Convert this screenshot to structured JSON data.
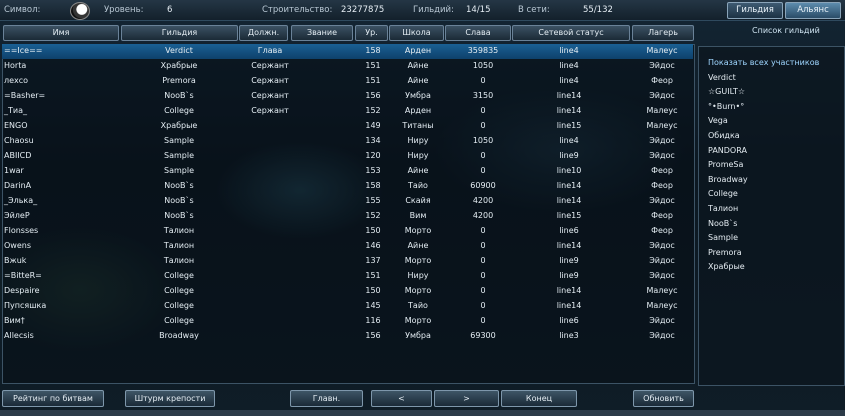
{
  "topbar": {
    "symbol_label": "Символ:",
    "level_label": "Уровень:",
    "level_value": "6",
    "construction_label": "Строительство:",
    "construction_value": "23277875",
    "guilds_label": "Гильдий:",
    "guilds_value": "14/15",
    "online_label": "В сети:",
    "online_value": "55/132"
  },
  "tabs": {
    "guild": "Гильдия",
    "alliance": "Альянс"
  },
  "alliance_caption": "Список гильдий",
  "columns": [
    "Имя",
    "Гильдия",
    "Должн.",
    "Звание",
    "Ур.",
    "Школа",
    "Слава",
    "Сетевой статус",
    "Лагерь"
  ],
  "rows": [
    {
      "name": "==Ice==",
      "guild": "Verdict",
      "rank": "Глава",
      "level": "158",
      "school": "Арден",
      "fame": "359835",
      "status": "line4",
      "camp": "Малеус",
      "selected": true
    },
    {
      "name": "Horta",
      "guild": "Храбрые",
      "rank": "Сержант",
      "level": "151",
      "school": "Айне",
      "fame": "1050",
      "status": "line4",
      "camp": "Эйдос"
    },
    {
      "name": "лехсо",
      "guild": "Premora",
      "rank": "Сержант",
      "level": "151",
      "school": "Айне",
      "fame": "0",
      "status": "line4",
      "camp": "Феор"
    },
    {
      "name": "=Basher=",
      "guild": "NooB`s",
      "rank": "Сержант",
      "level": "156",
      "school": "Умбра",
      "fame": "3150",
      "status": "line14",
      "camp": "Эйдос"
    },
    {
      "name": "_Тиа_",
      "guild": "College",
      "rank": "Сержант",
      "level": "152",
      "school": "Арден",
      "fame": "0",
      "status": "line14",
      "camp": "Малеус"
    },
    {
      "name": "ENGO",
      "guild": "Храбрые",
      "rank": "",
      "level": "149",
      "school": "Титаны",
      "fame": "0",
      "status": "line15",
      "camp": "Малеус"
    },
    {
      "name": "Chaosu",
      "guild": "Sample",
      "rank": "",
      "level": "134",
      "school": "Ниру",
      "fame": "1050",
      "status": "line4",
      "camp": "Эйдос"
    },
    {
      "name": "ABIICD",
      "guild": "Sample",
      "rank": "",
      "level": "120",
      "school": "Ниру",
      "fame": "0",
      "status": "line9",
      "camp": "Эйдос"
    },
    {
      "name": "1war",
      "guild": "Sample",
      "rank": "",
      "level": "153",
      "school": "Айне",
      "fame": "0",
      "status": "line10",
      "camp": "Феор"
    },
    {
      "name": "DarinA",
      "guild": "NooB`s",
      "rank": "",
      "level": "158",
      "school": "Тайо",
      "fame": "60900",
      "status": "line14",
      "camp": "Феор"
    },
    {
      "name": "_Элька_",
      "guild": "NooB`s",
      "rank": "",
      "level": "155",
      "school": "Скайя",
      "fame": "4200",
      "status": "line14",
      "camp": "Эйдос"
    },
    {
      "name": "ЭйлеР",
      "guild": "NooB`s",
      "rank": "",
      "level": "152",
      "school": "Вим",
      "fame": "4200",
      "status": "line15",
      "camp": "Феор"
    },
    {
      "name": "Flonsses",
      "guild": "Талион",
      "rank": "",
      "level": "150",
      "school": "Морто",
      "fame": "0",
      "status": "line6",
      "camp": "Феор"
    },
    {
      "name": "Owens",
      "guild": "Талион",
      "rank": "",
      "level": "146",
      "school": "Айне",
      "fame": "0",
      "status": "line14",
      "camp": "Эйдос"
    },
    {
      "name": "Bжuk",
      "guild": "Талион",
      "rank": "",
      "level": "137",
      "school": "Морто",
      "fame": "0",
      "status": "line9",
      "camp": "Эйдос"
    },
    {
      "name": "=BitteR=",
      "guild": "College",
      "rank": "",
      "level": "151",
      "school": "Ниру",
      "fame": "0",
      "status": "line9",
      "camp": "Эйдос"
    },
    {
      "name": "Despaire",
      "guild": "College",
      "rank": "",
      "level": "150",
      "school": "Морто",
      "fame": "0",
      "status": "line14",
      "camp": "Малеус"
    },
    {
      "name": "Пупсяшка",
      "guild": "College",
      "rank": "",
      "level": "145",
      "school": "Тайо",
      "fame": "0",
      "status": "line14",
      "camp": "Малеус"
    },
    {
      "name": "Вим†",
      "guild": "College",
      "rank": "",
      "level": "116",
      "school": "Морто",
      "fame": "0",
      "status": "line6",
      "camp": "Эйдос"
    },
    {
      "name": "Allecsis",
      "guild": "Broadway",
      "rank": "",
      "level": "156",
      "school": "Умбра",
      "fame": "69300",
      "status": "line3",
      "camp": "Эйдос"
    }
  ],
  "guild_list": [
    "Показать всех участников",
    "Verdict",
    "☆GUILT☆",
    "°•Burn•°",
    "Vega",
    "Обидка",
    "PANDORA",
    "PromeSa",
    "Broadway",
    "College",
    "Талион",
    "NooB`s",
    "Sample",
    "Premora",
    "Храбрые"
  ],
  "bottom": {
    "battle_rating": "Рейтинг по битвам",
    "fortress_assault": "Штурм крепости",
    "main": "Главн.",
    "prev": "<",
    "next": ">",
    "end": "Конец",
    "refresh": "Обновить"
  },
  "colors": {
    "selected_row": "#155a8c",
    "accent": "#9fd6ff"
  }
}
